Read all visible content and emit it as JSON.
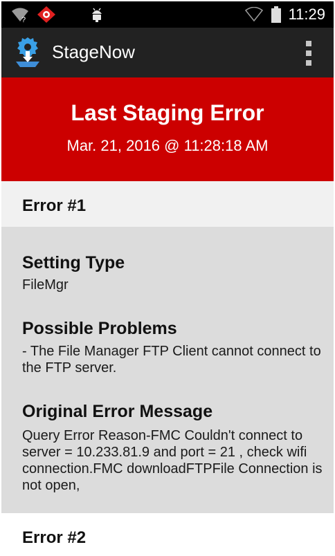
{
  "status_bar": {
    "time": "11:29",
    "icons": [
      "wifi-question-icon",
      "stagenow-notification-icon",
      "android-debug-icon",
      "wifi-signal-icon",
      "battery-icon"
    ]
  },
  "app_bar": {
    "title": "StageNow",
    "logo_icon": "stagenow-logo-icon",
    "menu_icon": "overflow-menu-icon"
  },
  "header": {
    "title": "Last Staging Error",
    "timestamp": "Mar. 21, 2016 @ 11:28:18 AM",
    "background": "#cc0000"
  },
  "errors": [
    {
      "label": "Error #1",
      "setting_type_title": "Setting Type",
      "setting_type": "FileMgr",
      "problems_title": "Possible Problems",
      "problems": "- The File Manager FTP Client cannot connect to the FTP server.",
      "message_title": "Original Error Message",
      "message": "Query Error Reason-FMC Couldn't connect to server = 10.233.81.9 and port = 21 , check wifi connection.FMC downloadFTPFile Connection is not open,"
    },
    {
      "label": "Error #2"
    }
  ]
}
